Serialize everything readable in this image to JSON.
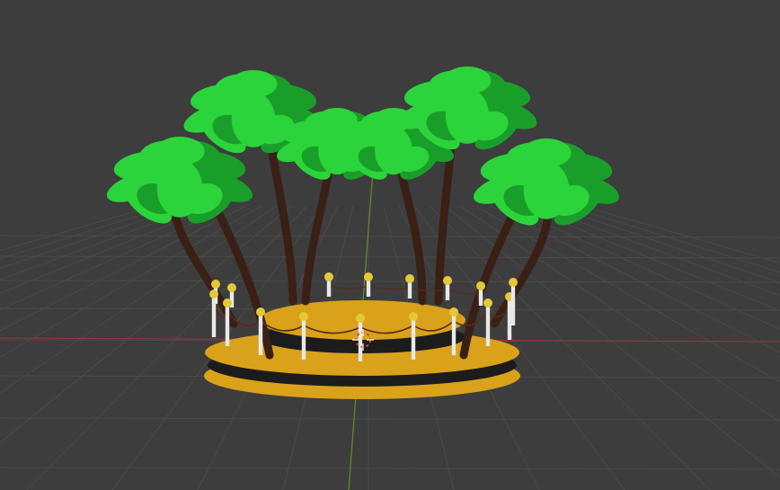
{
  "viewport": {
    "background": "#3d3d3d",
    "grid_color": "#4a4a4a",
    "x_axis_color": "#8a3a3a",
    "y_axis_color": "#6a8a2a",
    "grid": true
  },
  "scene": {
    "leaf_color": "#2bd43a",
    "leaf_dark": "#1a9e2a",
    "trunk_color": "#3a1f14",
    "base_gold": "#d9a21a",
    "base_dark": "#1c1c1c",
    "post_color": "#e8e8e8",
    "post_cap": "#e5c83a",
    "rope_color": "#5a2a1a",
    "cursor_color": "#d94a2a"
  }
}
